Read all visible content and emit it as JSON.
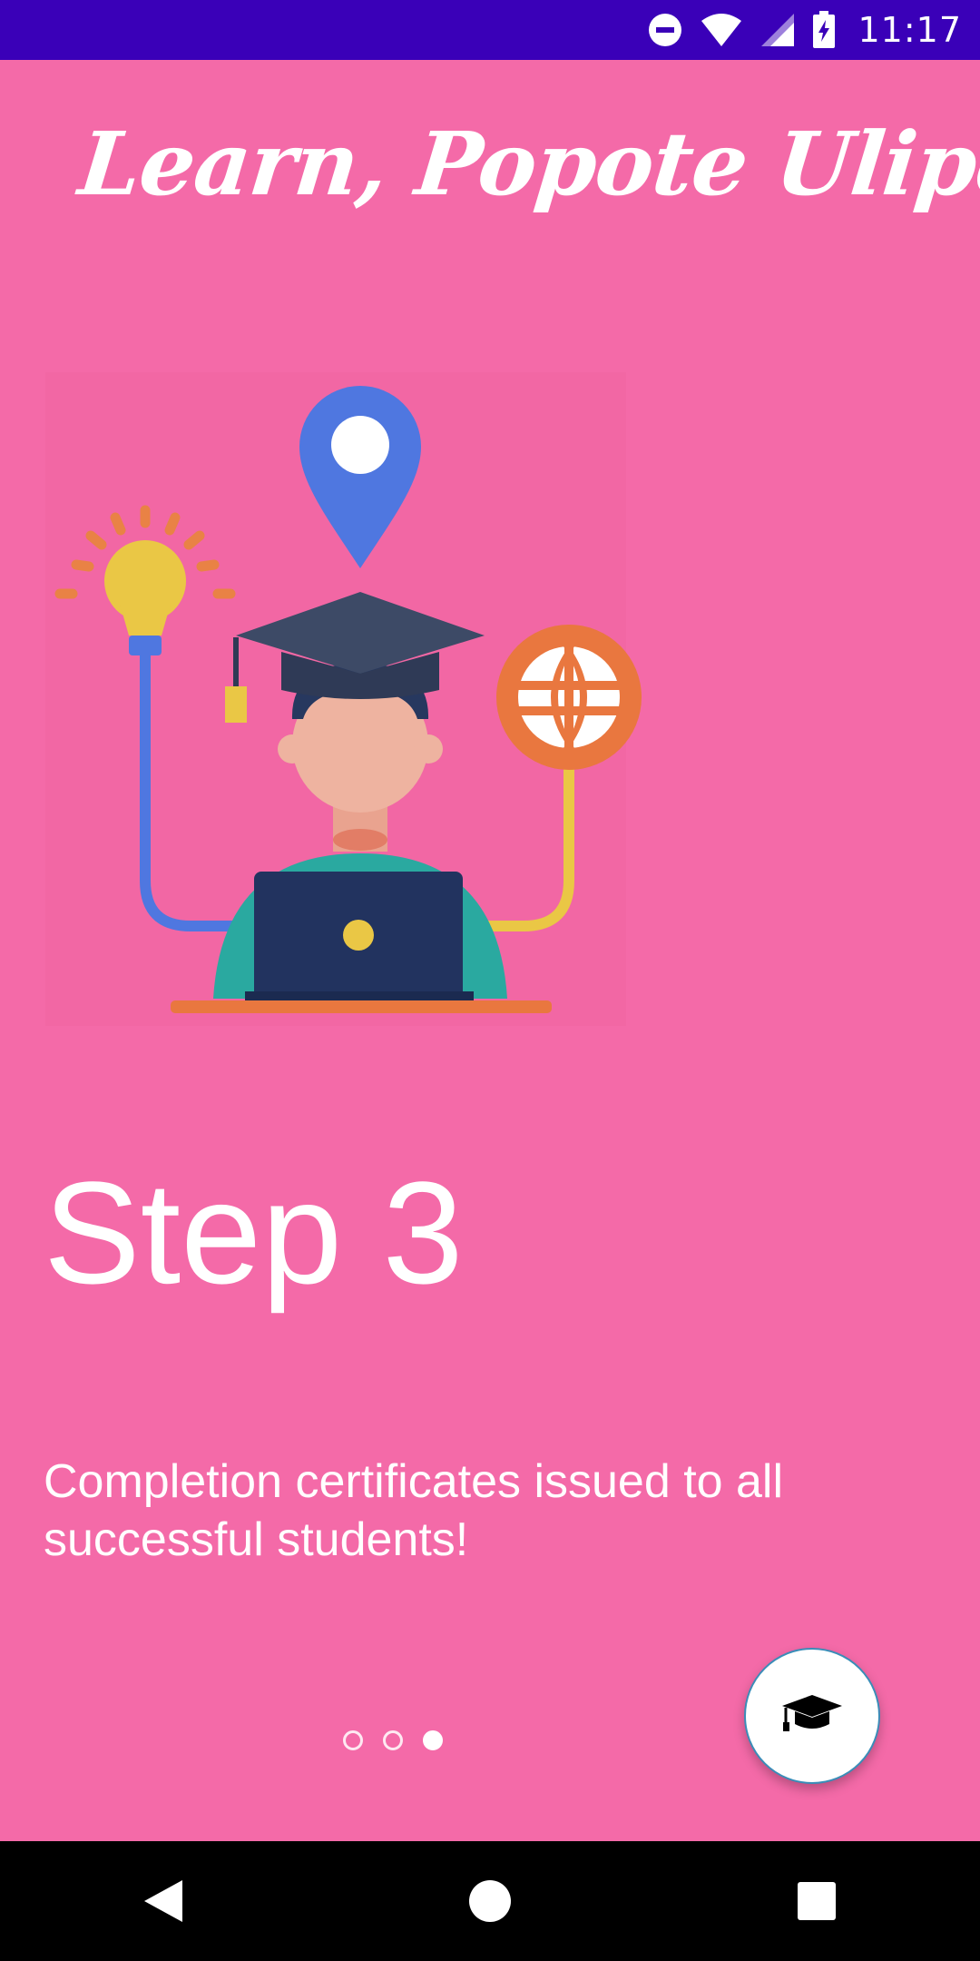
{
  "status_bar": {
    "time": "11:17",
    "icons": [
      "do-not-disturb-icon",
      "wifi-icon",
      "signal-icon",
      "battery-charging-icon"
    ]
  },
  "app": {
    "title": "Learn, Popote Ulipo!"
  },
  "onboarding": {
    "step_title": "Step 3",
    "description": "Completion certificates issued to all successful students!",
    "illustration_icon": "graduate-student-laptop-illustration",
    "pager": {
      "total": 3,
      "current": 3
    }
  },
  "fab": {
    "icon": "graduation-cap-icon"
  },
  "nav_bar": {
    "icons": [
      "back-icon",
      "home-icon",
      "recents-icon"
    ]
  },
  "colors": {
    "background": "#f46aa8",
    "status_bar": "#3a00b8",
    "nav_bar": "#000000",
    "text": "#ffffff"
  }
}
